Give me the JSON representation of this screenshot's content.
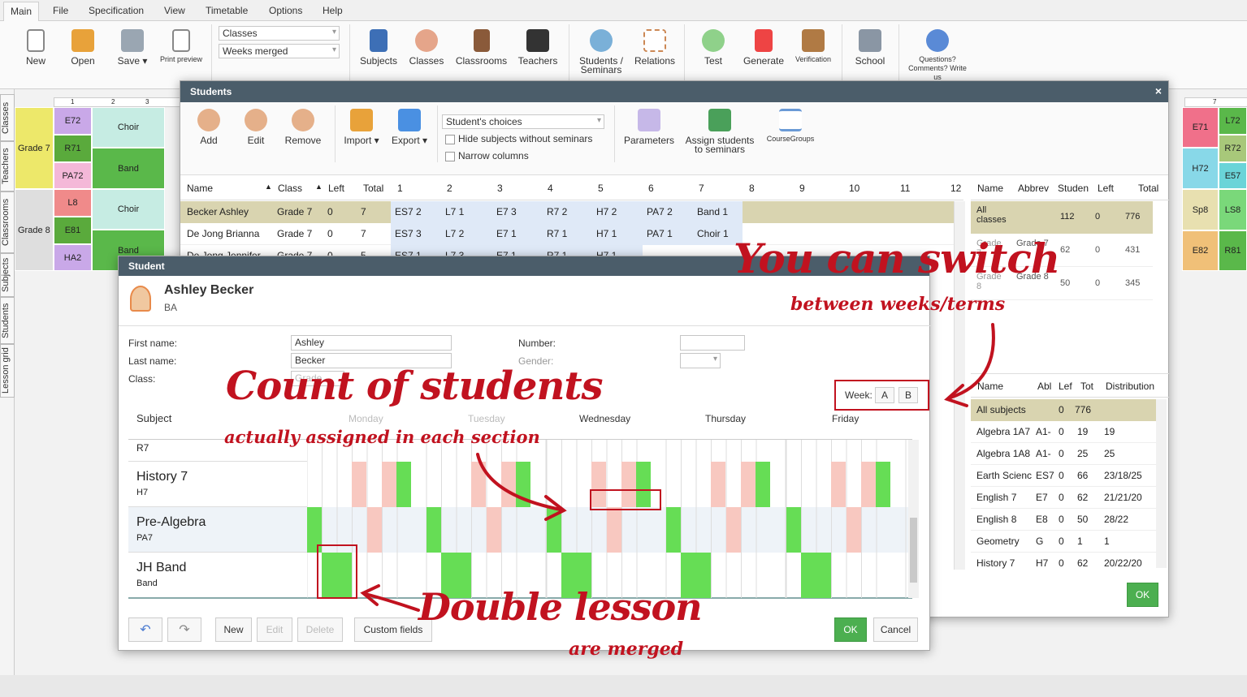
{
  "menu": [
    "Main",
    "File",
    "Specification",
    "View",
    "Timetable",
    "Options",
    "Help"
  ],
  "ribbon": {
    "new": "New",
    "open": "Open",
    "save": "Save",
    "print_preview": "Print preview",
    "combo_classes": "Classes",
    "combo_weeks": "Weeks merged",
    "subjects": "Subjects",
    "classes": "Classes",
    "classrooms": "Classrooms",
    "teachers": "Teachers",
    "students_seminars": "Students / Seminars",
    "relations": "Relations",
    "test": "Test",
    "generate": "Generate",
    "verification": "Verification",
    "school": "School",
    "questions": "Questions? Comments? Write us"
  },
  "vtabs": [
    "Classes",
    "Teachers",
    "Classrooms",
    "Subjects",
    "Students",
    "Lesson grid"
  ],
  "timetable": {
    "grade7": "Grade 7",
    "grade8": "Grade 8",
    "cells": [
      "E72",
      "R71",
      "PA72",
      "L8",
      "E81",
      "HA2",
      "Choir",
      "Band",
      "Choir",
      "Band",
      "E71",
      "L72",
      "R72",
      "H72",
      "E57",
      "Sp8",
      "LS8",
      "E82",
      "R81"
    ],
    "periods": [
      "1",
      "2",
      "3",
      "7"
    ]
  },
  "students_window": {
    "title": "Students",
    "add": "Add",
    "edit": "Edit",
    "remove": "Remove",
    "import": "Import",
    "export": "Export",
    "choices": "Student's choices",
    "hide_subjects": "Hide subjects without seminars",
    "narrow_columns": "Narrow columns",
    "parameters": "Parameters",
    "assign": "Assign students to seminars",
    "coursegroups": "CourseGroups",
    "headers": [
      "Name",
      "Class",
      "Left",
      "Total",
      "1",
      "2",
      "3",
      "4",
      "5",
      "6",
      "7",
      "8",
      "9",
      "10",
      "11",
      "12"
    ],
    "rows": [
      {
        "name": "Becker Ashley",
        "class": "Grade 7",
        "left": "0",
        "total": "7",
        "c": [
          "ES7 2",
          "L7 1",
          "E7 3",
          "R7 2",
          "H7 2",
          "PA7 2",
          "Band 1"
        ]
      },
      {
        "name": "De Jong Brianna",
        "class": "Grade 7",
        "left": "0",
        "total": "7",
        "c": [
          "ES7 3",
          "L7 2",
          "E7 1",
          "R7 1",
          "H7 1",
          "PA7 1",
          "Choir 1"
        ]
      },
      {
        "name": "De Jong Jennifer",
        "class": "Grade 7",
        "left": "0",
        "total": "5",
        "c": [
          "ES7 1",
          "L7 3",
          "E7 1",
          "R7 1",
          "H7 1",
          "",
          ""
        ]
      }
    ],
    "class_headers": [
      "Name",
      "Abbrev",
      "Studen",
      "Left",
      "Total"
    ],
    "class_rows": [
      [
        "All classes",
        "",
        "112",
        "0",
        "776"
      ],
      [
        "Grade 7",
        "Grade 7",
        "62",
        "0",
        "431"
      ],
      [
        "Grade 8",
        "Grade 8",
        "50",
        "0",
        "345"
      ]
    ],
    "subj_headers": [
      "Name",
      "Abl",
      "Lef",
      "Tot",
      "Distribution"
    ],
    "subj_rows": [
      [
        "All subjects",
        "",
        "0",
        "776",
        ""
      ],
      [
        "Algebra 1A7",
        "A1-",
        "0",
        "19",
        "19"
      ],
      [
        "Algebra 1A8",
        "A1-",
        "0",
        "25",
        "25"
      ],
      [
        "Earth Scienc",
        "ES7",
        "0",
        "66",
        "23/18/25"
      ],
      [
        "English 7",
        "E7",
        "0",
        "62",
        "21/21/20"
      ],
      [
        "English 8",
        "E8",
        "0",
        "50",
        "28/22"
      ],
      [
        "Geometry",
        "G",
        "0",
        "1",
        "1"
      ],
      [
        "History 7",
        "H7",
        "0",
        "62",
        "20/22/20"
      ]
    ],
    "ok": "OK"
  },
  "student_window": {
    "title": "Student",
    "name": "Ashley Becker",
    "abbr": "BA",
    "first_name_label": "First name:",
    "first_name": "Ashley",
    "last_name_label": "Last name:",
    "last_name": "Becker",
    "class_label": "Class:",
    "class_value": "Grade",
    "number_label": "Number:",
    "gender_label": "Gender:",
    "week_label": "Week:",
    "week_a": "A",
    "week_b": "B",
    "subject_header": "Subject",
    "days": [
      "Monday",
      "Tuesday",
      "Wednesday",
      "Thursday",
      "Friday"
    ],
    "subjects": [
      {
        "name": "R7",
        "abbr": ""
      },
      {
        "name": "History 7",
        "abbr": "H7"
      },
      {
        "name": "Pre-Algebra",
        "abbr": "PA7"
      },
      {
        "name": "JH Band",
        "abbr": "Band"
      }
    ],
    "new": "New",
    "edit": "Edit",
    "delete": "Delete",
    "custom_fields": "Custom fields",
    "ok": "OK",
    "cancel": "Cancel"
  },
  "annotations": {
    "switch": "You can switch",
    "switch_sub": "between weeks/terms",
    "count": "Count of students",
    "count_sub": "actually assigned in each section",
    "double": "Double lesson",
    "double_sub": "are merged"
  },
  "colors": {
    "green": "#66dd55",
    "pink": "#f8c8c0",
    "blue": "#dfe9f7",
    "selected": "#d9d4b0",
    "title": "#4b5d6a",
    "red": "#c1121f"
  }
}
